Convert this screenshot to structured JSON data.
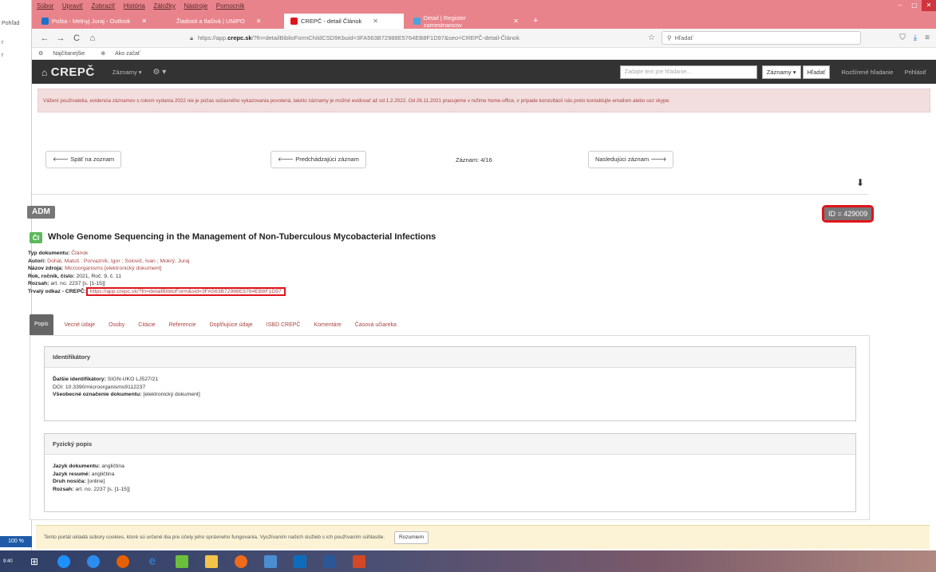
{
  "left_strip": {
    "items": [
      "Pohľad",
      "r",
      "r"
    ],
    "zoom": "100 %"
  },
  "window": {
    "menu": [
      "Súbor",
      "Upraviť",
      "Zobraziť",
      "História",
      "Záložky",
      "Nástroje",
      "Pomocník"
    ],
    "controls": [
      "–",
      "▢",
      "✕"
    ]
  },
  "tabs": [
    {
      "label": "Pošta - Melnyj Juraj - Outlook",
      "icon_color": "#1a73c8"
    },
    {
      "label": "Žiadosti a tlačivá | UNIPO",
      "icon_color": "#e8838b"
    },
    {
      "label": "CREPČ - detail Článok",
      "icon_color": "#e0141b",
      "active": true
    },
    {
      "label": "Detail | Register zamestnancov",
      "icon_color": "#4aa3df"
    }
  ],
  "tab_close": "✕",
  "tab_add": "+",
  "navbar": {
    "back": "←",
    "forward": "→",
    "reload": "C",
    "home": "⌂",
    "url_prefix": "https://app.",
    "url_host": "crepc.sk",
    "url_rest": "/?fn=detailBiblioFormChildCSD9Kbuid=3FA563B72988E5764EB8F1D97&seo=CREPČ-detail-Článok",
    "search_placeholder": "Hľadať",
    "shield": "⛉",
    "download": "⤓",
    "menu": "≡"
  },
  "bookmarks": [
    "Najčítanejšie",
    "Ako začať"
  ],
  "site": {
    "brand": "CREPČ",
    "nav_records": "Záznamy ▾",
    "nav_settings": "⚙ ▾",
    "search_placeholder": "Zadajte text pre hľadanie...",
    "search_scope": "Záznamy ▾",
    "search_button": "Hľadať",
    "advanced": "Rozšírené hľadanie",
    "login": "Prihlásiť"
  },
  "alert": "Vážení používatelia, evidencia záznamov s rokom vydania 2022 nie je počas súčasného vykazovania povolená, takéto záznamy je možné evidovať až od 1.2.2022. Od 26.11.2021 pracujeme v režime home-office, v prípade konzultácií nás preto kontaktujte emailom alebo cez skype.",
  "record_nav": {
    "back_list": "🡐 Späť na zoznam",
    "prev": "🡐 Predchádzajúci záznam",
    "position": "Záznam: 4/16",
    "next": "Nasledujúci záznam 🡒"
  },
  "record": {
    "adm": "ADM",
    "id": "ID = 429009",
    "type_badge": "ČI",
    "title": "Whole Genome Sequencing in the Management of Non-Tuberculous Mycobacterial Infections",
    "meta": [
      {
        "label": "Typ dokumentu:",
        "value": "Článok"
      },
      {
        "label": "Autori:",
        "value": "Dohál, Matúš ; Porvazník, Igor ; Solovič, Ivan ; Mokrý, Juraj"
      },
      {
        "label": "Názov zdroja:",
        "value": "Microorganisms [elektronický dokument]"
      },
      {
        "label": "Rok, ročník, číslo:",
        "value": "2021, Roč. 9, č. 11"
      },
      {
        "label": "Rozsah:",
        "value": "art. no. 2237 [s. [1-15]]"
      }
    ],
    "permalink_label": "Trvalý odkaz - CREPČ:",
    "permalink": "https://app.crepc.sk/?fn=detailBiblioForm&sid=3FA563B72988E5764EB8F1D97"
  },
  "detail_tabs": [
    "Popis",
    "Vecné údaje",
    "Osoby",
    "Citácie",
    "Referencie",
    "Doplňujúce údaje",
    "ISBD CREPČ",
    "Komentáre",
    "Časová učiareka"
  ],
  "panels": {
    "identifiers": {
      "title": "Identifikátory",
      "rows": [
        {
          "label": "Ďalšie identifikátory:",
          "value": "SIGN-UKO LJ527/21"
        },
        {
          "label": "",
          "value": "DOI: 10.3390/microorganisms9112237"
        },
        {
          "label": "Všeobecné označenie dokumentu:",
          "value": "[elektronický dokument]"
        }
      ]
    },
    "physical": {
      "title": "Fyzický popis",
      "rows": [
        {
          "label": "Jazyk dokumentu:",
          "value": "angličtina"
        },
        {
          "label": "Jazyk resumé:",
          "value": "angličtina"
        },
        {
          "label": "Druh nosiča:",
          "value": "[online]"
        },
        {
          "label": "Rozsah:",
          "value": "art. no. 2237 [s. [1-15]]"
        }
      ]
    }
  },
  "cookie": {
    "text": "Tento portál ukladá súbory cookies, ktoré sú určené iba pre účely jeho správneho fungovania. Využívaním našich služieb s ich používaním súhlasíte.",
    "button": "Rozumiem"
  },
  "taskbar": {
    "time": "9:40",
    "apps": [
      {
        "name": "start-icon",
        "color": "#ffffff"
      },
      {
        "name": "windows-icon",
        "color": "#1e90ff"
      },
      {
        "name": "chrome-icon",
        "color": "#2d8cf0"
      },
      {
        "name": "firefox-icon",
        "color": "#e66000"
      },
      {
        "name": "edge-icon",
        "color": "#3277bc"
      },
      {
        "name": "tool-icon",
        "color": "#6cbf3c"
      },
      {
        "name": "folder-icon",
        "color": "#f3c44a"
      },
      {
        "name": "firefox-icon-2",
        "color": "#f06a1b"
      },
      {
        "name": "app-icon",
        "color": "#4a8ed1"
      },
      {
        "name": "outlook-icon",
        "color": "#0f6cbd"
      },
      {
        "name": "word-icon",
        "color": "#2b5797"
      },
      {
        "name": "powerpoint-icon",
        "color": "#d24726"
      }
    ]
  }
}
